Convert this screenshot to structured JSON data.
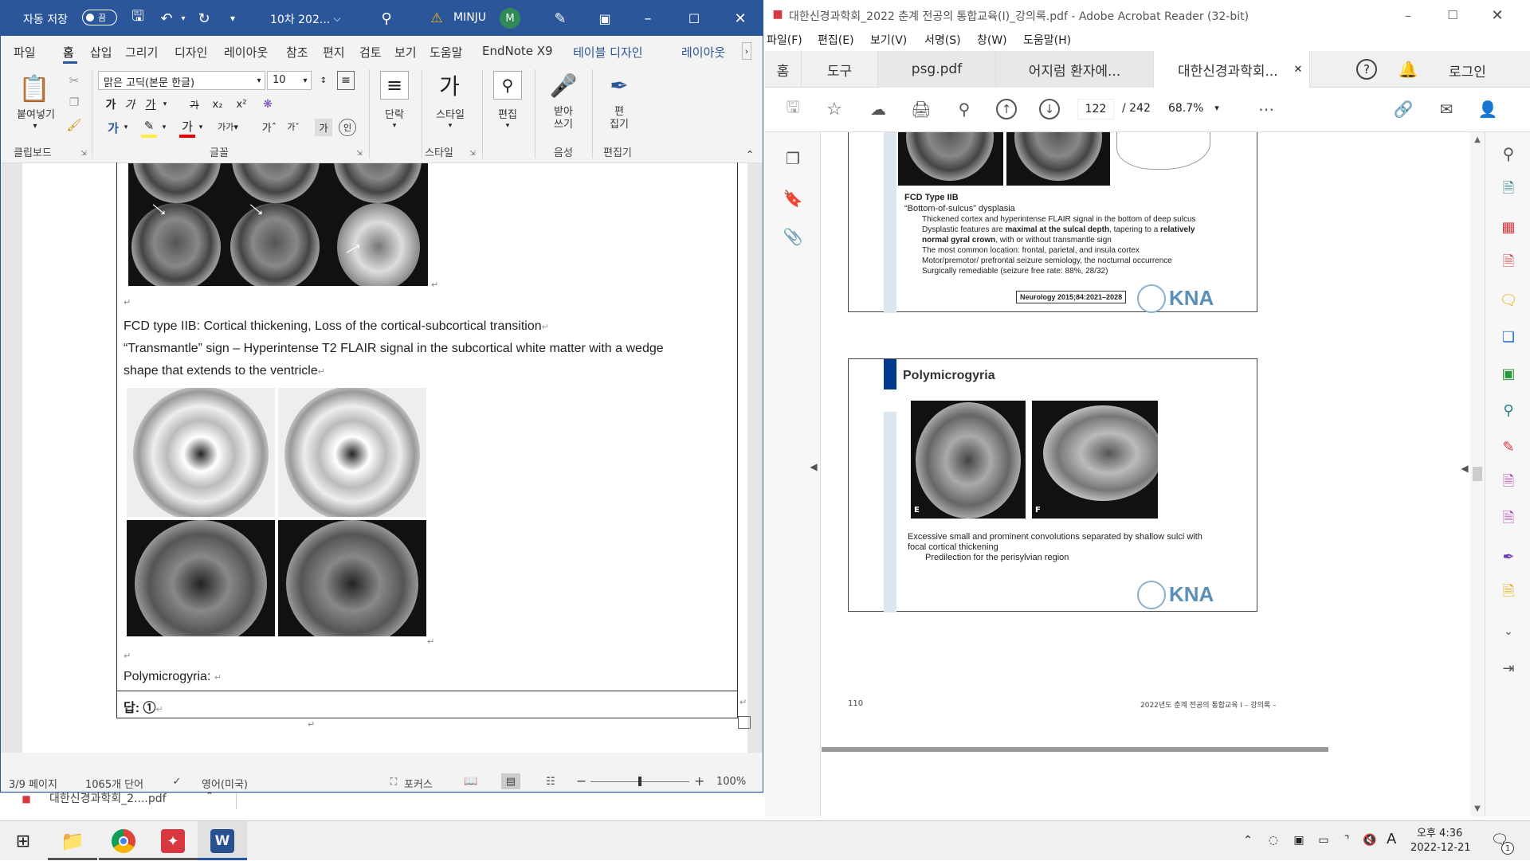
{
  "word": {
    "autosave_label": "자동 저장",
    "autosave_state": "끔",
    "doc_title": "10차 202...",
    "warning_user": "MINJU",
    "avatar_initial": "M",
    "menu": [
      "파일",
      "홈",
      "삽입",
      "그리기",
      "디자인",
      "레이아웃",
      "참조",
      "편지",
      "검토",
      "보기",
      "도움말",
      "EndNote X9",
      "테이블 디자인",
      "레이아웃"
    ],
    "ribbon": {
      "paste": "붙여넣기",
      "clipboard": "클립보드",
      "font_name": "맑은 고딕(본문 한글)",
      "font_size": "10",
      "font_group": "글꼴",
      "paragraph": "단락",
      "styles": "스타일",
      "styles_group": "스타일",
      "editing": "편집",
      "dictate": "받아\n쓰기",
      "voice": "음성",
      "editor": "편\n집기",
      "editor_group": "편집기"
    },
    "doc": {
      "line1": "FCD type IIB: Cortical thickening, Loss of the cortical-subcortical transition",
      "line2a": "“Transmantle” sign – Hyperintense T2 FLAIR signal in the subcortical white matter with a wedge",
      "line2b": "shape that extends to the ventricle",
      "line3": "Polymicrogyria:",
      "answer": "답: ①"
    },
    "status": {
      "page": "3/9 페이지",
      "words": "1065개 단어",
      "lang": "영어(미국)",
      "focus": "포커스",
      "zoom": "100%"
    }
  },
  "acrobat": {
    "title": "대한신경과학회_2022 춘계 전공의 통합교육(I)_강의록.pdf - Adobe Acrobat Reader (32-bit)",
    "menu": [
      "파일(F)",
      "편집(E)",
      "보기(V)",
      "서명(S)",
      "창(W)",
      "도움말(H)"
    ],
    "tabs": [
      "홈",
      "도구",
      "psg.pdf",
      "어지럼 환자에...",
      "대한신경과학회..."
    ],
    "login": "로그인",
    "page_current": "122",
    "page_total": "/ 242",
    "zoom": "68.7%",
    "slide1": {
      "title": "FCD Type IIB",
      "subtitle": "“Bottom-of-sulcus” dysplasia",
      "b1": "Thickened cortex and hyperintense FLAIR signal in the bottom of deep sulcus",
      "b2a": "Dysplastic features are ",
      "b2b": "maximal at the sulcal depth",
      "b2c": ", tapering to a ",
      "b2d": "relatively",
      "b3a": "normal gyral crown",
      "b3b": ", with or without transmantle sign",
      "b4": "The most common location: frontal, parietal, and insula cortex",
      "b5": "Motor/premotor/ prefrontal seizure semiology, the nocturnal occurrence",
      "b6": "Surgically remediable (seizure free rate: 88%, 28/32)",
      "citation": "Neurology 2015;84:2021–2028",
      "logo": "KNA"
    },
    "slide2": {
      "title": "Polymicrogyria",
      "label_e": "E",
      "label_f": "F",
      "t1": "Excessive small and prominent convolutions separated by shallow sulci with",
      "t2": "focal cortical thickening",
      "t3": "Predilection for the perisylvian region",
      "logo": "KNA"
    },
    "footer_left": "110",
    "footer_right": "2022년도 춘계 전공의 통합교육 I  – 강의록 –"
  },
  "taskbar": {
    "download_item": "대한신경과학회_2....pdf",
    "time": "오후 4:36",
    "date": "2022-12-21",
    "ime": "A",
    "notif_count": "1"
  },
  "colors": {
    "word_blue": "#2b579a",
    "acrobat_red": "#d7373f",
    "kna_blue": "#5a8fb8"
  }
}
